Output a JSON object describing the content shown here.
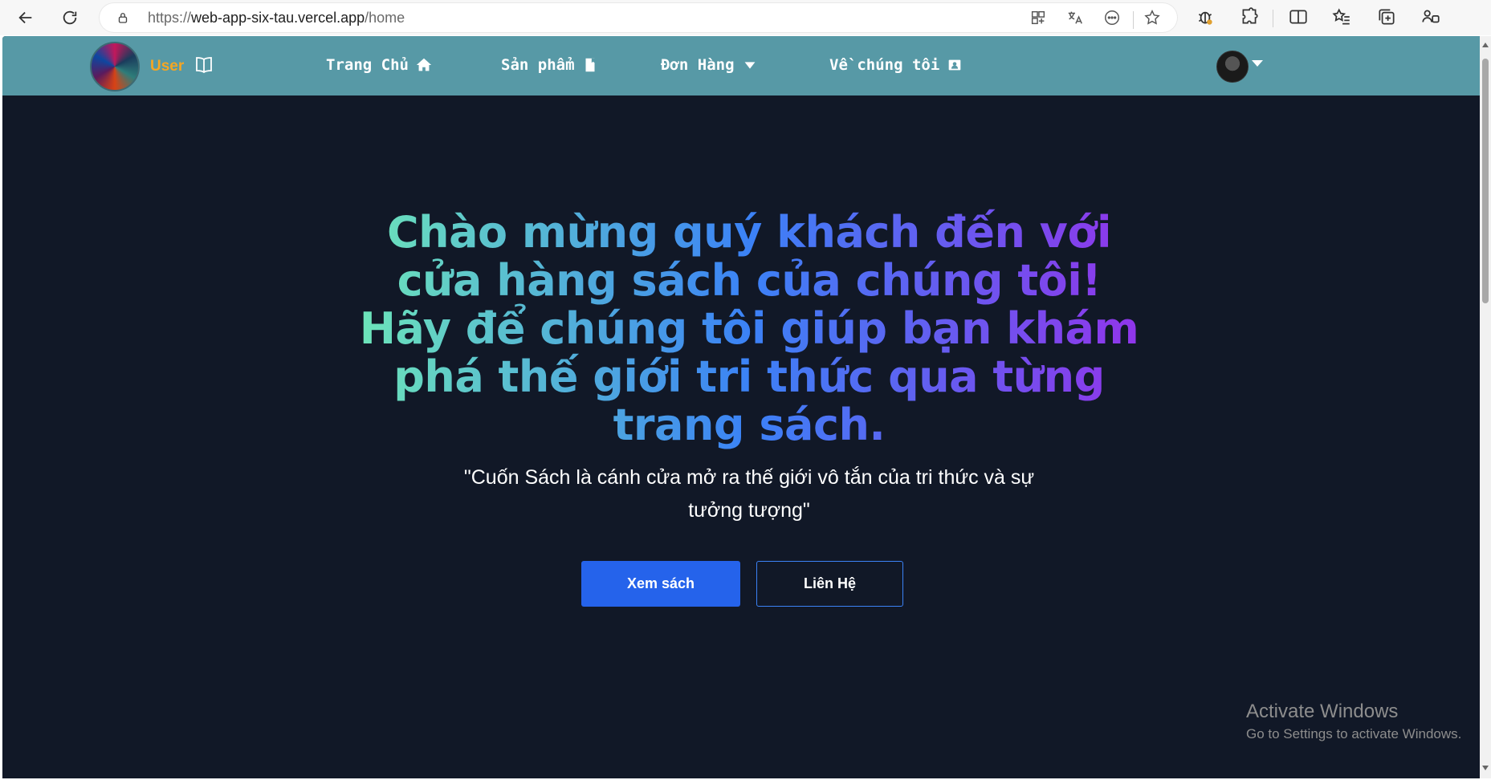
{
  "browser": {
    "url_proto": "https://",
    "url_host": "web-app-six-tau.vercel.app",
    "url_path": "/home"
  },
  "navbar": {
    "brand_label": "User",
    "items": [
      {
        "label": "Trang Chủ",
        "icon": "home-icon"
      },
      {
        "label": "Sản phẩm",
        "icon": "book-icon"
      },
      {
        "label": "Đơn Hàng",
        "icon": "caret-down-icon"
      },
      {
        "label": "Về chúng tôi",
        "icon": "contact-card-icon"
      }
    ],
    "bg_color": "#5799a6",
    "brand_color": "#f5a623"
  },
  "hero": {
    "title": "Chào mừng quý khách đến với cửa hàng sách của chúng tôi! Hãy để chúng tôi giúp bạn khám phá thế giới tri thức qua từng trang sách.",
    "quote": "\"Cuốn Sách là cánh cửa mở ra thế giới vô tắn của tri thức và sự tưởng tượng\"",
    "primary_button": "Xem sách",
    "secondary_button": "Liên Hệ",
    "primary_color": "#2563eb",
    "bg_color": "#111827"
  },
  "watermark": {
    "line1": "Activate Windows",
    "line2": "Go to Settings to activate Windows."
  }
}
